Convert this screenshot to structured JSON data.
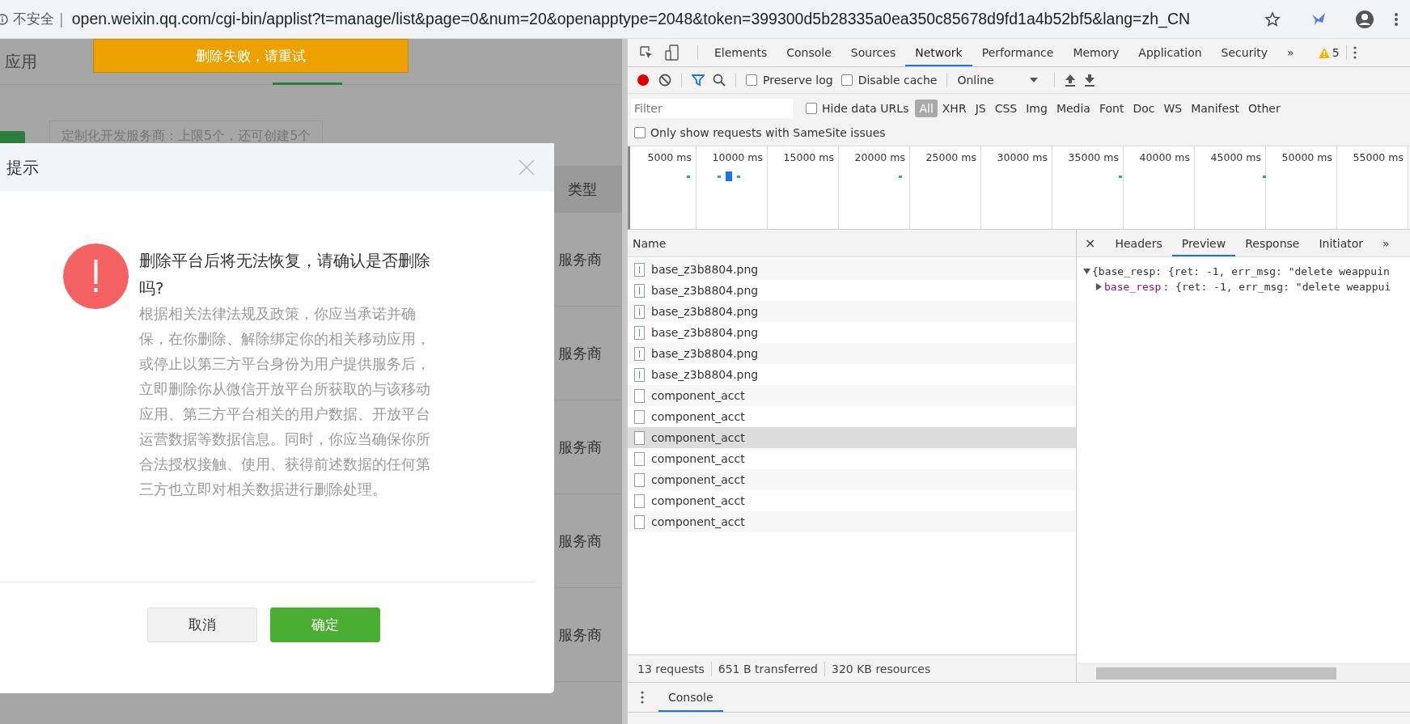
{
  "address_bar": {
    "security_label": "不安全",
    "separator": "|",
    "url": "open.weixin.qq.com/cgi-bin/applist?t=manage/list&page=0&num=20&openapptype=2048&token=399300d5b28335a0ea350c85678d9fd1a4b52bf5&lang=zh_CN"
  },
  "page": {
    "nav_tabs": [
      {
        "label": "应用",
        "selected": false
      },
      {
        "selected": true
      }
    ],
    "notice": "定制化开发服务商：上限5个，还可创建5个",
    "table": {
      "header": "类型",
      "rows": [
        "服务商",
        "服务商",
        "服务商",
        "服务商",
        "服务商"
      ]
    }
  },
  "toast": {
    "text": "删除失败，请重试"
  },
  "dialog": {
    "title": "提示",
    "heading": "删除平台后将无法恢复，请确认是否删除吗?",
    "body": "根据相关法律法规及政策，你应当承诺并确保，在你删除、解除绑定你的相关移动应用，或停止以第三方平台身份为用户提供服务后，立即删除你从微信开放平台所获取的与该移动应用、第三方平台相关的用户数据、开放平台运营数据等数据信息。同时，你应当确保你所合法授权接触、使用、获得前述数据的任何第三方也立即对相关数据进行删除处理。",
    "buttons": [
      {
        "label": "取消",
        "kind": "secondary"
      },
      {
        "label": "确定",
        "kind": "primary"
      }
    ]
  },
  "devtools": {
    "tabs": [
      {
        "label": "Elements",
        "selected": false
      },
      {
        "label": "Console",
        "selected": false
      },
      {
        "label": "Sources",
        "selected": false
      },
      {
        "label": "Network",
        "selected": true
      },
      {
        "label": "Performance",
        "selected": false
      },
      {
        "label": "Memory",
        "selected": false
      },
      {
        "label": "Application",
        "selected": false
      },
      {
        "label": "Security",
        "selected": false
      }
    ],
    "more_tabs": "»",
    "warning_count": "5",
    "toolbar": {
      "recording": true,
      "filter_active": true,
      "preserve_log": {
        "label": "Preserve log",
        "checked": false
      },
      "disable_cache": {
        "label": "Disable cache",
        "checked": false
      },
      "throttling": "Online"
    },
    "filter": {
      "placeholder": "Filter",
      "hide_data_urls": {
        "label": "Hide data URLs",
        "checked": false
      },
      "types": [
        {
          "label": "All",
          "selected": true
        },
        {
          "label": "XHR",
          "selected": false
        },
        {
          "label": "JS",
          "selected": false
        },
        {
          "label": "CSS",
          "selected": false
        },
        {
          "label": "Img",
          "selected": false
        },
        {
          "label": "Media",
          "selected": false
        },
        {
          "label": "Font",
          "selected": false
        },
        {
          "label": "Doc",
          "selected": false
        },
        {
          "label": "WS",
          "selected": false
        },
        {
          "label": "Manifest",
          "selected": false
        },
        {
          "label": "Other",
          "selected": false
        }
      ],
      "samesite": {
        "label": "Only show requests with SameSite issues",
        "checked": false
      }
    },
    "timeline_ticks": [
      "5000 ms",
      "10000 ms",
      "15000 ms",
      "20000 ms",
      "25000 ms",
      "30000 ms",
      "35000 ms",
      "40000 ms",
      "45000 ms",
      "50000 ms",
      "55000 ms"
    ],
    "requests": {
      "column": "Name",
      "rows": [
        {
          "name": "base_z3b8804.png",
          "kind": "image",
          "selected": false
        },
        {
          "name": "base_z3b8804.png",
          "kind": "image",
          "selected": false
        },
        {
          "name": "base_z3b8804.png",
          "kind": "image",
          "selected": false
        },
        {
          "name": "base_z3b8804.png",
          "kind": "image",
          "selected": false
        },
        {
          "name": "base_z3b8804.png",
          "kind": "image",
          "selected": false
        },
        {
          "name": "base_z3b8804.png",
          "kind": "image",
          "selected": false
        },
        {
          "name": "component_acct",
          "kind": "document",
          "selected": false
        },
        {
          "name": "component_acct",
          "kind": "document",
          "selected": false
        },
        {
          "name": "component_acct",
          "kind": "document",
          "selected": true
        },
        {
          "name": "component_acct",
          "kind": "document",
          "selected": false
        },
        {
          "name": "component_acct",
          "kind": "document",
          "selected": false
        },
        {
          "name": "component_acct",
          "kind": "document",
          "selected": false
        },
        {
          "name": "component_acct",
          "kind": "document",
          "selected": false
        }
      ]
    },
    "detail": {
      "close": "×",
      "tabs": [
        {
          "label": "Headers",
          "selected": false
        },
        {
          "label": "Preview",
          "selected": true
        },
        {
          "label": "Response",
          "selected": false
        },
        {
          "label": "Initiator",
          "selected": false
        }
      ],
      "more_tabs": "»",
      "preview": [
        {
          "text": "{base_resp: {ret: -1, err_msg: \"delete weappuin",
          "expanded": true
        },
        {
          "key": "base_resp",
          "text": ": {ret: -1, err_msg: \"delete weappui",
          "expanded": false
        }
      ]
    },
    "summary": [
      "13 requests",
      "651 B transferred",
      "320 KB resources"
    ],
    "drawer": {
      "tabs": [
        {
          "label": "Console",
          "selected": true
        }
      ]
    }
  }
}
